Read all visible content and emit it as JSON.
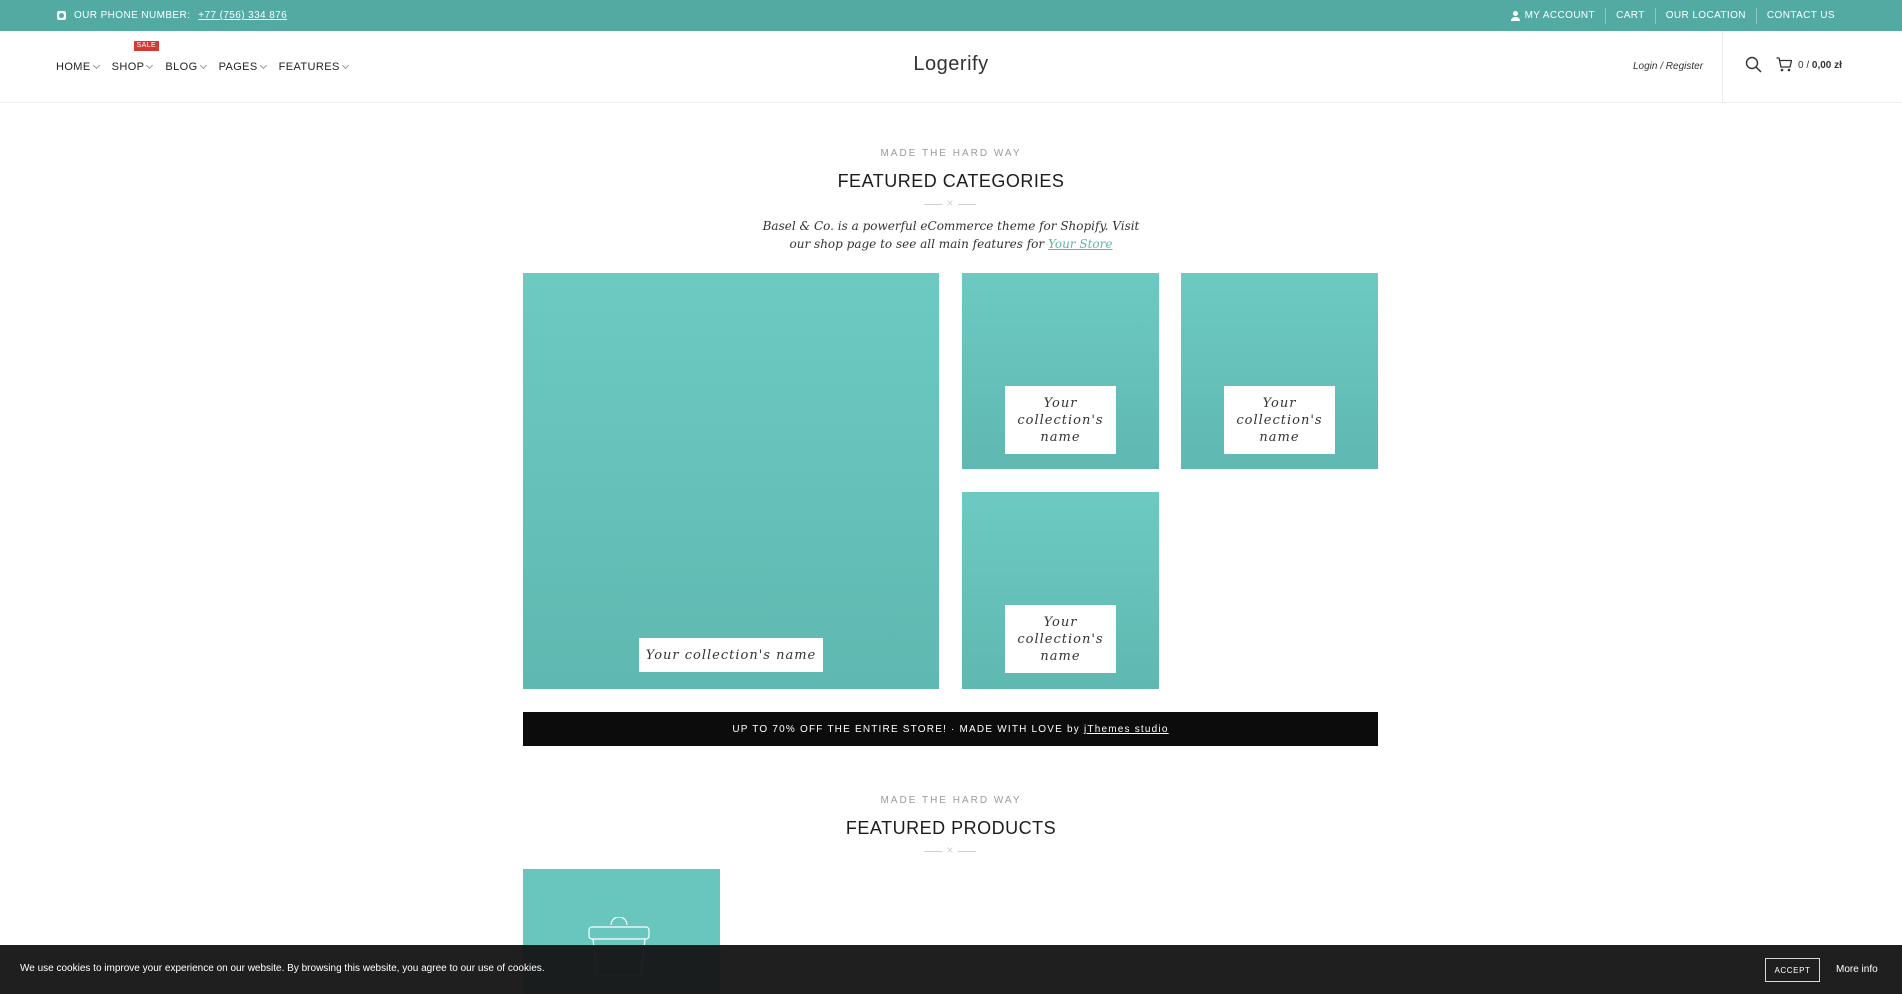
{
  "topbar": {
    "phone_label": "OUR PHONE NUMBER:",
    "phone_number": "+77 (756) 334 876",
    "links": [
      "MY ACCOUNT",
      "CART",
      "OUR LOCATION",
      "CONTACT US"
    ]
  },
  "header": {
    "nav": [
      {
        "label": "HOME",
        "has_dropdown": true
      },
      {
        "label": "SHOP",
        "has_dropdown": true,
        "badge": "SALE"
      },
      {
        "label": "BLOG",
        "has_dropdown": true
      },
      {
        "label": "PAGES",
        "has_dropdown": true
      },
      {
        "label": "FEATURES",
        "has_dropdown": true
      }
    ],
    "logo": "Logerify",
    "login": "Login / Register",
    "cart_count": "0",
    "cart_separator": "/",
    "cart_total": "0,00 zł"
  },
  "categories_section": {
    "eyebrow": "MADE THE HARD WAY",
    "title": "FEATURED CATEGORIES",
    "intro_line1": "Basel & Co. is a powerful eCommerce theme for Shopify. Visit",
    "intro_line2": "our shop page to see all main features for",
    "intro_link": "Your Store",
    "tiles": [
      {
        "label": "Your collection's name"
      },
      {
        "label": "Your collection's name"
      },
      {
        "label": "Your collection's name"
      },
      {
        "label": "Your collection's name"
      }
    ]
  },
  "promo": {
    "text": "UP TO 70% OFF THE ENTIRE STORE! · MADE WITH LOVE",
    "by": "by",
    "studio": "jThemes studio"
  },
  "products_section": {
    "eyebrow": "MADE THE HARD WAY",
    "title": "FEATURED PRODUCTS"
  },
  "cookie": {
    "message": "We use cookies to improve your experience on our website. By browsing this website, you agree to our use of cookies.",
    "accept": "ACCEPT",
    "more_info": "More info"
  },
  "colors": {
    "topbar": "#52aaa3",
    "tile": "#66c3bc",
    "accent_link": "#5eb6ad",
    "sale_badge": "#d23b33",
    "promo_bg": "#0c0c0c"
  },
  "icons": [
    "phone-icon",
    "user-icon",
    "search-icon",
    "cart-icon",
    "bag-icon",
    "chevron-down-icon"
  ]
}
